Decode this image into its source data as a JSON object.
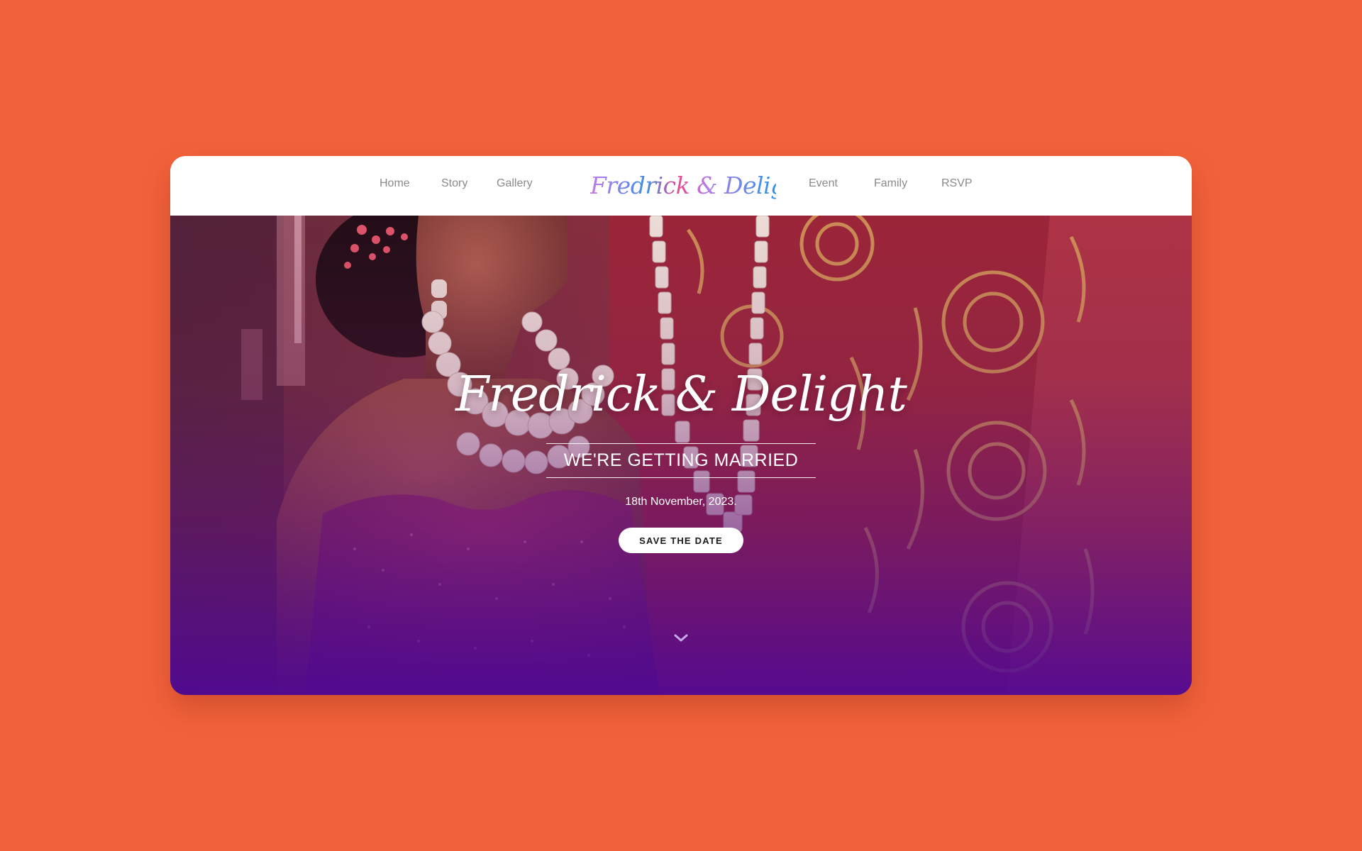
{
  "nav": {
    "left_links": [
      "Home",
      "Story",
      "Gallery"
    ],
    "brand": "Fredrick & Delight",
    "right_links": [
      "Event",
      "Family",
      "RSVP"
    ]
  },
  "hero": {
    "title": "Fredrick & Delight",
    "tagline": "WE'RE GETTING MARRIED",
    "date": "18th November, 2023.",
    "button_label": "SAVE THE DATE",
    "scroll_icon": "chevron-down-icon",
    "photo_description_icon": "couple-photo"
  },
  "colors": {
    "page_background": "#f2623a",
    "card_background": "#ffffff",
    "nav_text": "#8a8a8a",
    "overlay_bottom": "#50089a",
    "button_background": "#ffffff"
  }
}
